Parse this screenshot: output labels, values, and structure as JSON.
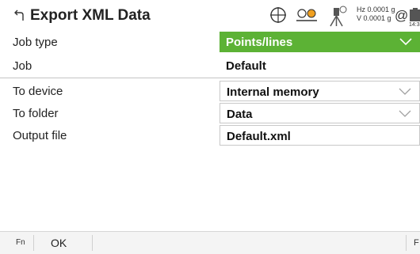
{
  "title": {
    "back_icon": "back-arrow-icon",
    "text": "Export XML Data"
  },
  "status": {
    "icons": [
      "target-icon",
      "prism-icon",
      "instrument-icon",
      "at-icon",
      "battery-icon"
    ],
    "hz": "Hz 0.0001 g",
    "v": "V 0.0001 g",
    "at": "@",
    "time": "14:3"
  },
  "rows": [
    {
      "label": "Job type",
      "value": "Points/lines"
    },
    {
      "label": "Job",
      "value": "Default"
    },
    {
      "label": "To device",
      "value": "Internal memory"
    },
    {
      "label": "To folder",
      "value": "Data"
    },
    {
      "label": "Output file",
      "value": "Default.xml"
    }
  ],
  "footer": {
    "fn": "Fn",
    "ok": "OK",
    "f_right": "F"
  },
  "colors": {
    "accent_green": "#5cb235",
    "border": "#c8c8c8"
  }
}
